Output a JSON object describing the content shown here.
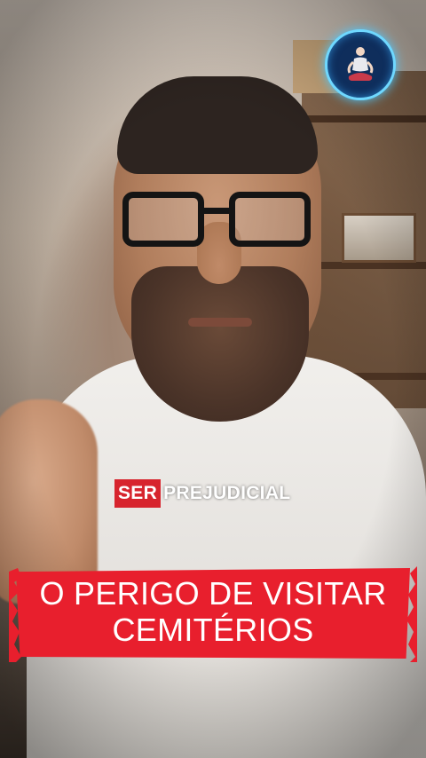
{
  "video": {
    "tag_highlight": "SER",
    "tag_text": "PREJUDICIAL",
    "headline_line1": "O PERIGO DE VISITAR",
    "headline_line2": "CEMITÉRIOS"
  },
  "logo": {
    "icon": "meditating-figure-icon",
    "ring_color": "#6fd8ff"
  },
  "colors": {
    "banner_red": "#e81f2d",
    "tag_red": "#d7242d"
  }
}
